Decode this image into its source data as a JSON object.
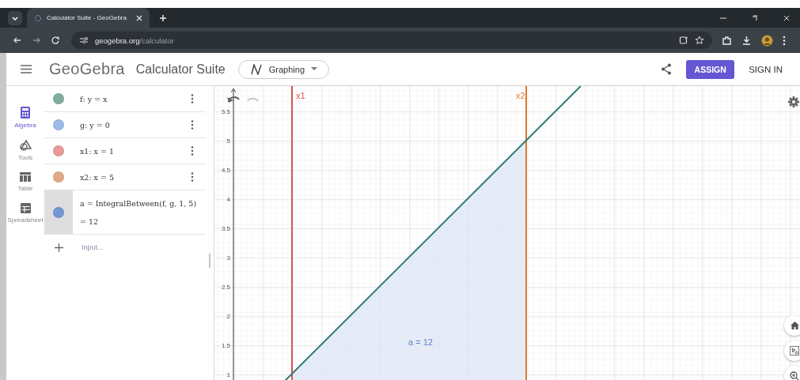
{
  "browser": {
    "tab_title": "Calculator Suite - GeoGebra",
    "url_host": "geogebra.org",
    "url_path": "/calculator"
  },
  "header": {
    "logo": "GeoGebra",
    "app_title": "Calculator Suite",
    "app_picker": "Graphing",
    "assign": "ASSIGN",
    "sign_in": "SIGN IN"
  },
  "sidebar": [
    {
      "label": "Algebra",
      "kind": "algebra",
      "selected": true
    },
    {
      "label": "Tools",
      "kind": "tools",
      "selected": false
    },
    {
      "label": "Table",
      "kind": "table",
      "selected": false
    },
    {
      "label": "Spreadsheet",
      "kind": "spreadsheet",
      "selected": false
    }
  ],
  "algebra": {
    "items": [
      {
        "definition": "f: y = x",
        "color": "#7fae9e",
        "selected": false
      },
      {
        "definition": "g: y = 0",
        "color": "#9dbbe8",
        "selected": false
      },
      {
        "definition": "x1: x = 1",
        "color": "#e69a9a",
        "selected": false
      },
      {
        "definition": "x2: x = 5",
        "color": "#e2a988",
        "selected": false
      },
      {
        "definition": "a = IntegralBetween(f, g, 1, 5)",
        "value": "= 12",
        "color": "#7298d6",
        "selected": true
      }
    ],
    "input_placeholder": "Input..."
  },
  "graphics": {
    "yticks": [
      "5.5",
      "5",
      "4.5",
      "4",
      "3.5",
      "3",
      "2.5",
      "2",
      "1.5",
      "1"
    ],
    "x1_label": "x1",
    "x2_label": "x2",
    "area_label": "a = 12"
  }
}
